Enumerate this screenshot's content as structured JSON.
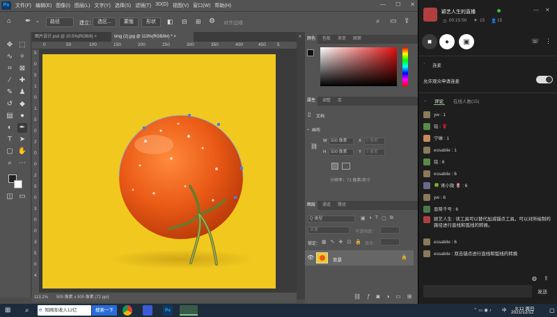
{
  "photoshop": {
    "app_logo": "Ps",
    "menus": [
      "文件(F)",
      "编辑(E)",
      "图像(I)",
      "图层(L)",
      "文字(Y)",
      "选择(S)",
      "滤镜(T)",
      "3D(D)",
      "视图(V)",
      "窗口(W)",
      "帮助(H)"
    ],
    "options": {
      "mode": "路径",
      "make_label": "建立：",
      "selection_button": "选区...",
      "mask_button": "蒙版",
      "shape_button": "形状",
      "align_edges": "对齐边缘"
    },
    "doc_tabs": [
      {
        "label": "图片设计.psd @ 10.5%(RGB/8)",
        "active": false
      },
      {
        "label": "timg (2).jpg @ 113%(RGB/8#) *",
        "active": true
      }
    ],
    "ruler_h": [
      "0",
      "50",
      "100",
      "150",
      "200",
      "250",
      "300",
      "350",
      "400",
      "450",
      "5"
    ],
    "ruler_v": [
      "5",
      "0",
      "5",
      "1",
      "0",
      "1",
      "5",
      "0",
      "2",
      "0",
      "0",
      "2",
      "5",
      "0",
      "3",
      "0",
      "0",
      "3",
      "5",
      "0",
      "4"
    ],
    "status": {
      "zoom": "113.2%",
      "doc_size": "500 像素 x 500 像素 (72 ppi)"
    },
    "color_panel": {
      "tabs": [
        "颜色",
        "色板",
        "渐变",
        "图案"
      ]
    },
    "properties_panel": {
      "tabs": [
        "属性",
        "调整",
        "库"
      ],
      "doc_label": "文档",
      "canvas_label": "画布",
      "w_label": "W",
      "w_value": "500 像素",
      "h_label": "H",
      "h_value": "500 像素",
      "x_label": "X",
      "x_value": "0 像素",
      "y_label": "Y",
      "y_value": "0 像素",
      "resolution": "分辨率：72 像素/英寸"
    },
    "layers_panel": {
      "tabs": [
        "图层",
        "通道",
        "路径"
      ],
      "filter_label": "Q 类型",
      "blend_mode": "正常",
      "opacity_label": "不透明度：",
      "lock_label": "锁定：",
      "fill_label": "填充：",
      "layer_name": "背景"
    }
  },
  "taskbar": {
    "search_text": "知网年收入12亿",
    "search_button": "搜索一下",
    "time": "9:12 周日",
    "date": "2021/12/12",
    "ime": "中"
  },
  "stream": {
    "title": "颖艺人生的直播",
    "timer": "00:15:50",
    "likes": "15",
    "viewers": "15",
    "connect_label": "连麦",
    "allow_label": "允许观众申请连麦",
    "tabs": [
      "评论",
      "在线人数(15)"
    ],
    "comments": [
      {
        "name": "yw",
        "text": "1",
        "color": "#8a7a5a"
      },
      {
        "name": "铭",
        "text": "🌹",
        "color": "#5a8a4a"
      },
      {
        "name": "宁琳",
        "text": "1",
        "color": "#c98a5a"
      },
      {
        "name": "essabile",
        "text": "1",
        "color": "#8a7a5a"
      },
      {
        "name": "铭",
        "text": "6",
        "color": "#5a8a4a"
      },
      {
        "name": "essabile",
        "text": "6",
        "color": "#8a7a5a"
      },
      {
        "name": "🍀 肾小微 🌷",
        "text": "6",
        "color": "#6a6a8a"
      },
      {
        "name": "yw",
        "text": "6",
        "color": "#8a7a5a"
      },
      {
        "name": "恩降千号",
        "text": "6",
        "color": "#4a7a4a"
      },
      {
        "name": "颖艺人生",
        "text": "读工具可以替代加减锚点工具，可以对所绘制的路径进行直线和弧线的转换。",
        "color": "#b04040"
      },
      {
        "name": "essabile",
        "text": "6",
        "color": "#8a7a5a"
      },
      {
        "name": "essabile",
        "text": "双击锚点进行直线和弧线的转换",
        "color": "#8a7a5a"
      }
    ],
    "send_button": "发送",
    "colors": {
      "accent": "#7fd07f",
      "bg": "#1e1e1e"
    }
  }
}
